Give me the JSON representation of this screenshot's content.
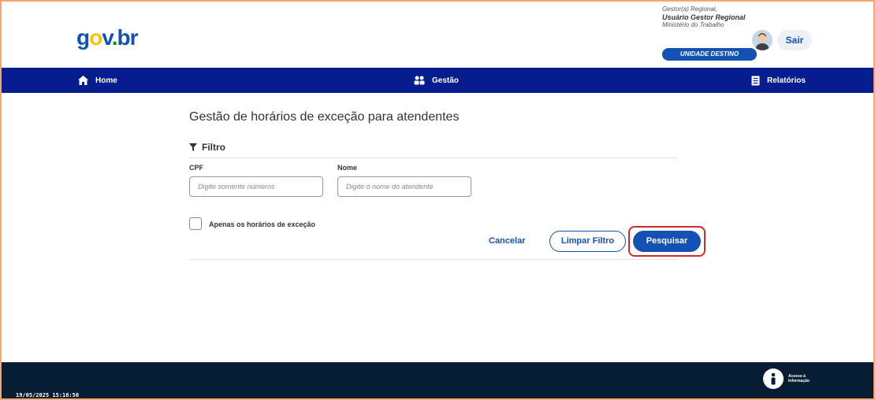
{
  "header": {
    "logo_parts": [
      "g",
      "o",
      "v",
      ".",
      "br"
    ],
    "user_role": "Gestor(a) Regional,",
    "user_name": "Usuário Gestor Regional",
    "user_org": "Ministério do Trabalho",
    "unit_badge": "UNIDADE DESTINO",
    "logout_label": "Sair"
  },
  "nav": {
    "items": [
      {
        "label": "Home",
        "icon": "home-icon"
      },
      {
        "label": "Gestão",
        "icon": "users-icon"
      },
      {
        "label": "Relatórios",
        "icon": "document-icon"
      }
    ]
  },
  "main": {
    "title": "Gestão de horários de exceção para atendentes",
    "filter_label": "Filtro",
    "cpf": {
      "label": "CPF",
      "placeholder": "Digite somente números",
      "value": ""
    },
    "nome": {
      "label": "Nome",
      "placeholder": "Digite o nome do atendente",
      "value": ""
    },
    "checkbox_label": "Apenas os horários de exceção",
    "checkbox_checked": false,
    "buttons": {
      "cancel": "Cancelar",
      "clear": "Limpar Filtro",
      "search": "Pesquisar"
    }
  },
  "footer": {
    "datetime": "19/05/2025 15:16:50",
    "access_info_line1": "Acesso à",
    "access_info_line2": "Informação"
  },
  "colors": {
    "brand_blue": "#1351b4",
    "nav_bg": "#071d8f",
    "footer_bg": "#071d33",
    "highlight_red": "#d22a2a",
    "frame_border": "#f2a66b"
  }
}
